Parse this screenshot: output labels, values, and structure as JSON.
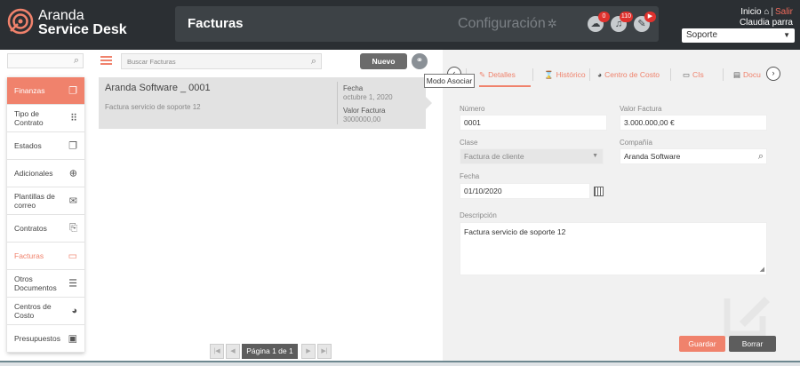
{
  "header": {
    "brand_line1": "Aranda",
    "brand_line2": "Service Desk",
    "page_title": "Facturas",
    "config_label": "Configuración",
    "badges": {
      "cloud": "0",
      "bell": "110",
      "tools": "▶"
    },
    "inicio_label": "Inicio",
    "salir_label": "Salir",
    "user_name": "Claudia parra",
    "project_select": "Soporte"
  },
  "nav": {
    "items": [
      {
        "label": "Finanzas",
        "icon": "copy-icon"
      },
      {
        "label": "Tipo de Contrato",
        "icon": "grid-icon"
      },
      {
        "label": "Estados",
        "icon": "copy-outline-icon"
      },
      {
        "label": "Adicionales",
        "icon": "plus-circle-icon"
      },
      {
        "label": "Plantillas de correo",
        "icon": "envelope-icon"
      },
      {
        "label": "Contratos",
        "icon": "contract-icon"
      },
      {
        "label": "Facturas",
        "icon": "invoice-icon"
      },
      {
        "label": "Otros Documentos",
        "icon": "document-icon"
      },
      {
        "label": "Centros de Costo",
        "icon": "pie-icon"
      },
      {
        "label": "Presupuestos",
        "icon": "money-icon"
      }
    ]
  },
  "list": {
    "search_placeholder": "Buscar Facturas",
    "new_button": "Nuevo",
    "tooltip": "Modo Asociar",
    "card": {
      "name": "Aranda Software _ 0001",
      "description": "Factura servicio de soporte 12",
      "fecha_label": "Fecha",
      "fecha_value": "octubre 1, 2020",
      "valor_label": "Valor Factura",
      "valor_value": "3000000,00"
    },
    "pager_label": "Página 1 de 1"
  },
  "detail": {
    "tabs": [
      "Detalles",
      "Histórico",
      "Centro de Costo",
      "CIs",
      "Docu"
    ],
    "numero_label": "Número",
    "numero_value": "0001",
    "valor_label": "Valor Factura",
    "valor_value": "3.000.000,00 €",
    "clase_label": "Clase",
    "clase_value": "Factura de cliente",
    "compania_label": "Compañía",
    "compania_value": "Aranda Software",
    "fecha_label": "Fecha",
    "fecha_value": "01/10/2020",
    "descripcion_label": "Descripción",
    "descripcion_value": "Factura servicio de soporte 12",
    "save_button": "Guardar",
    "delete_button": "Borrar"
  },
  "colors": {
    "accent": "#f0826c",
    "header_bg": "#2b2f33",
    "badge": "#e0322e"
  }
}
